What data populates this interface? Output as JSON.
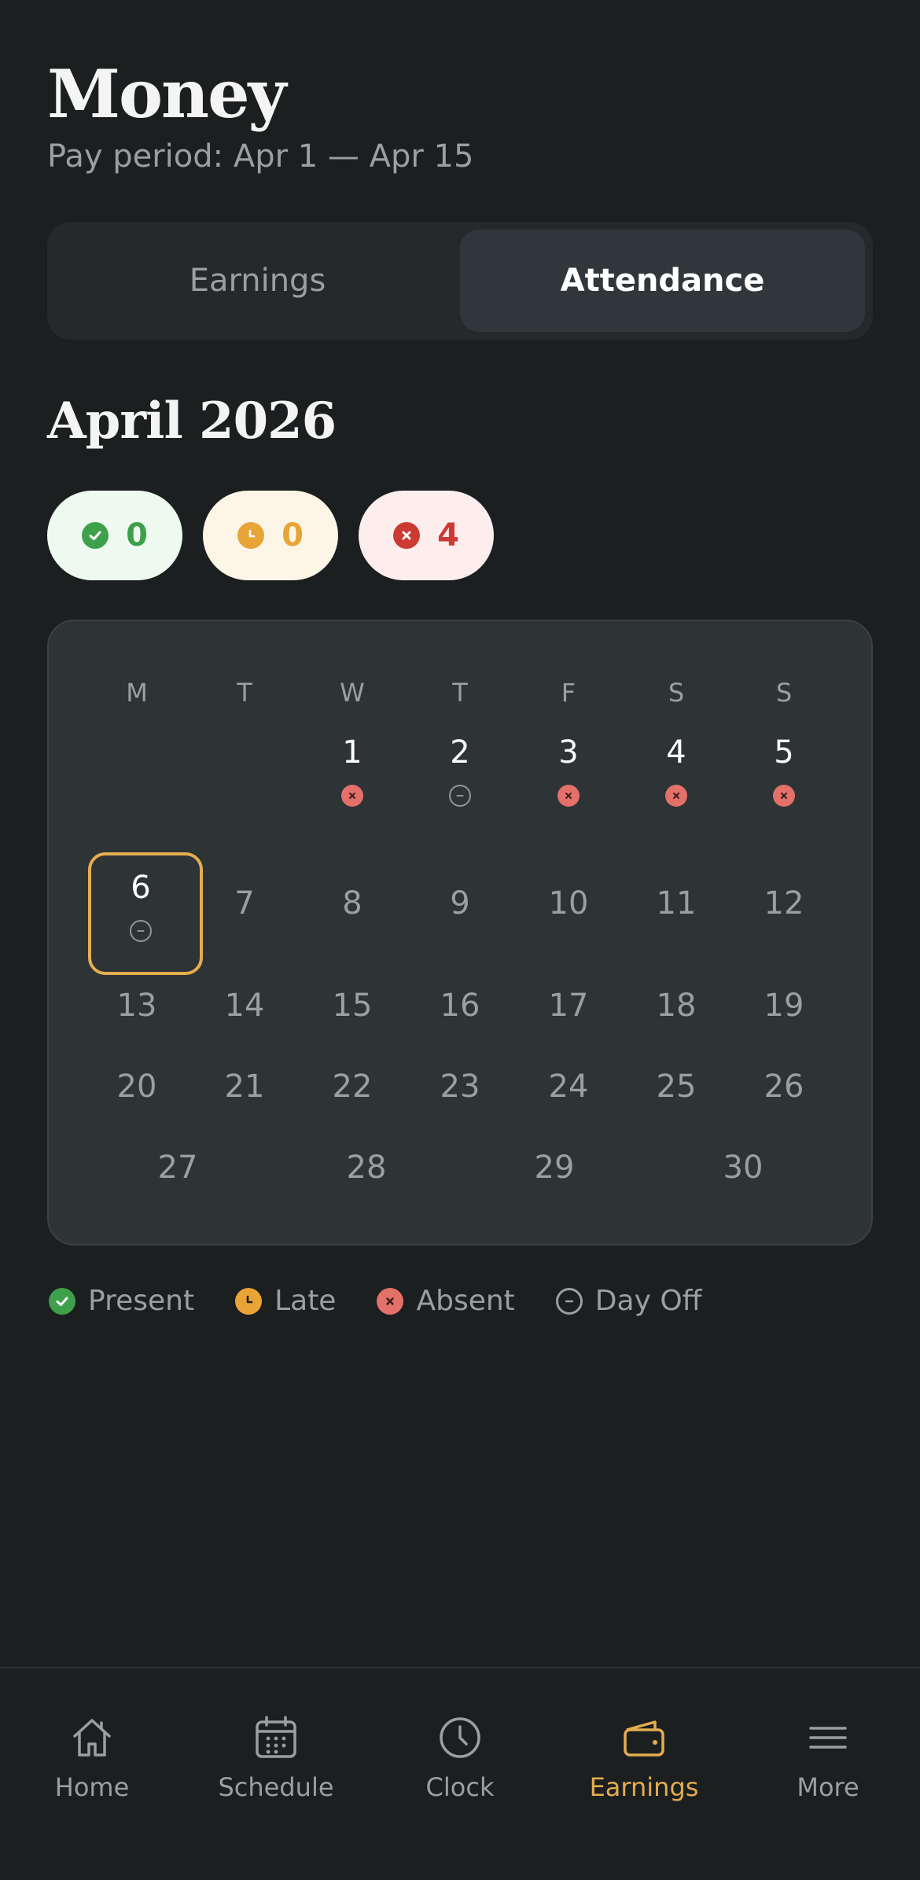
{
  "header": {
    "title": "Money",
    "pay_period": "Pay period: Apr 1 — Apr 15"
  },
  "tabs": [
    {
      "label": "Earnings",
      "active": false
    },
    {
      "label": "Attendance",
      "active": true
    }
  ],
  "month": "April 2026",
  "summary": {
    "present": "0",
    "late": "0",
    "absent": "4"
  },
  "calendar": {
    "weekdays": [
      "M",
      "T",
      "W",
      "T",
      "F",
      "S",
      "S"
    ],
    "days": [
      {
        "day": "1",
        "status": "absent"
      },
      {
        "day": "2",
        "status": "dayoff"
      },
      {
        "day": "3",
        "status": "absent"
      },
      {
        "day": "4",
        "status": "absent"
      },
      {
        "day": "5",
        "status": "absent"
      },
      {
        "day": "6",
        "status": "dayoff",
        "today": true
      },
      {
        "day": "7"
      },
      {
        "day": "8"
      },
      {
        "day": "9"
      },
      {
        "day": "10"
      },
      {
        "day": "11"
      },
      {
        "day": "12"
      },
      {
        "day": "13"
      },
      {
        "day": "14"
      },
      {
        "day": "15"
      },
      {
        "day": "16"
      },
      {
        "day": "17"
      },
      {
        "day": "18"
      },
      {
        "day": "19"
      },
      {
        "day": "20"
      },
      {
        "day": "21"
      },
      {
        "day": "22"
      },
      {
        "day": "23"
      },
      {
        "day": "24"
      },
      {
        "day": "25"
      },
      {
        "day": "26"
      },
      {
        "day": "27"
      },
      {
        "day": "28"
      },
      {
        "day": "29"
      },
      {
        "day": "30"
      }
    ]
  },
  "legend": [
    {
      "key": "present",
      "label": "Present"
    },
    {
      "key": "late",
      "label": "Late"
    },
    {
      "key": "absent",
      "label": "Absent"
    },
    {
      "key": "dayoff",
      "label": "Day Off"
    }
  ],
  "nav": [
    {
      "label": "Home",
      "icon": "home-icon",
      "active": false
    },
    {
      "label": "Schedule",
      "icon": "calendar-icon",
      "active": false
    },
    {
      "label": "Clock",
      "icon": "clock-icon",
      "active": false
    },
    {
      "label": "Earnings",
      "icon": "wallet-icon",
      "active": true
    },
    {
      "label": "More",
      "icon": "menu-icon",
      "active": false
    }
  ],
  "colors": {
    "accent": "#e4ad4f",
    "present": "#3fa04b",
    "late": "#e8a436",
    "absent": "#cc3a34"
  }
}
